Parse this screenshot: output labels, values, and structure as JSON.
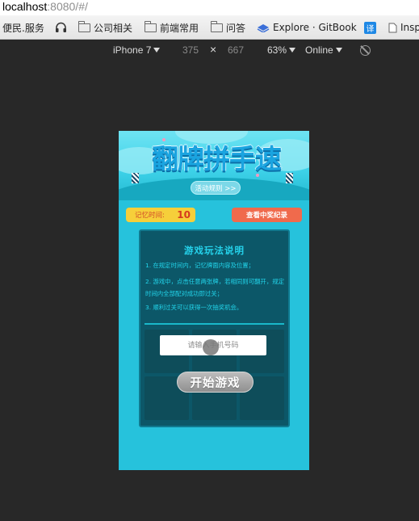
{
  "browser": {
    "address": {
      "host": "localhost",
      "rest": ":8080/#/"
    },
    "bookmarks": [
      {
        "label": "便民.服务",
        "icon": "none"
      },
      {
        "label": "",
        "icon": "headphones-icon"
      },
      {
        "label": "公司相关",
        "icon": "folder-icon"
      },
      {
        "label": "前端常用",
        "icon": "folder-icon"
      },
      {
        "label": "问答",
        "icon": "folder-icon"
      },
      {
        "label": "Explore · GitBook",
        "icon": "gitbook-icon"
      },
      {
        "label": "译",
        "icon": "translate-icon"
      },
      {
        "label": "Insp",
        "icon": "page-icon"
      }
    ]
  },
  "devtools": {
    "device": "iPhone 7",
    "width": "375",
    "times": "×",
    "height": "667",
    "zoom": "63%",
    "network": "Online"
  },
  "game": {
    "title": "翻牌拼手速",
    "rules_button": "活动规则 >>",
    "memory_label": "记忆时间:",
    "memory_value": "10",
    "record_button": "查看中奖纪录",
    "instructions_title": "游戏玩法说明",
    "instructions": [
      "1. 在规定时间内，记忆牌面内容及位置；",
      "2. 游戏中，点击任意两张牌，若相同则可翻开，规定时间内全部配对成功即过关；",
      "3. 顺利过关可以获得一次抽奖机会。"
    ],
    "phone_placeholder": "请输入手机号码",
    "start_button": "开始游戏"
  },
  "colors": {
    "viewport_bg": "#26c2dc",
    "board_bg": "#0c5768",
    "accent_cyan": "#25d3ec",
    "memory_badge": "#f6cf3a",
    "record_button": "#f06a4c",
    "start_button": "#a8a8a8"
  }
}
